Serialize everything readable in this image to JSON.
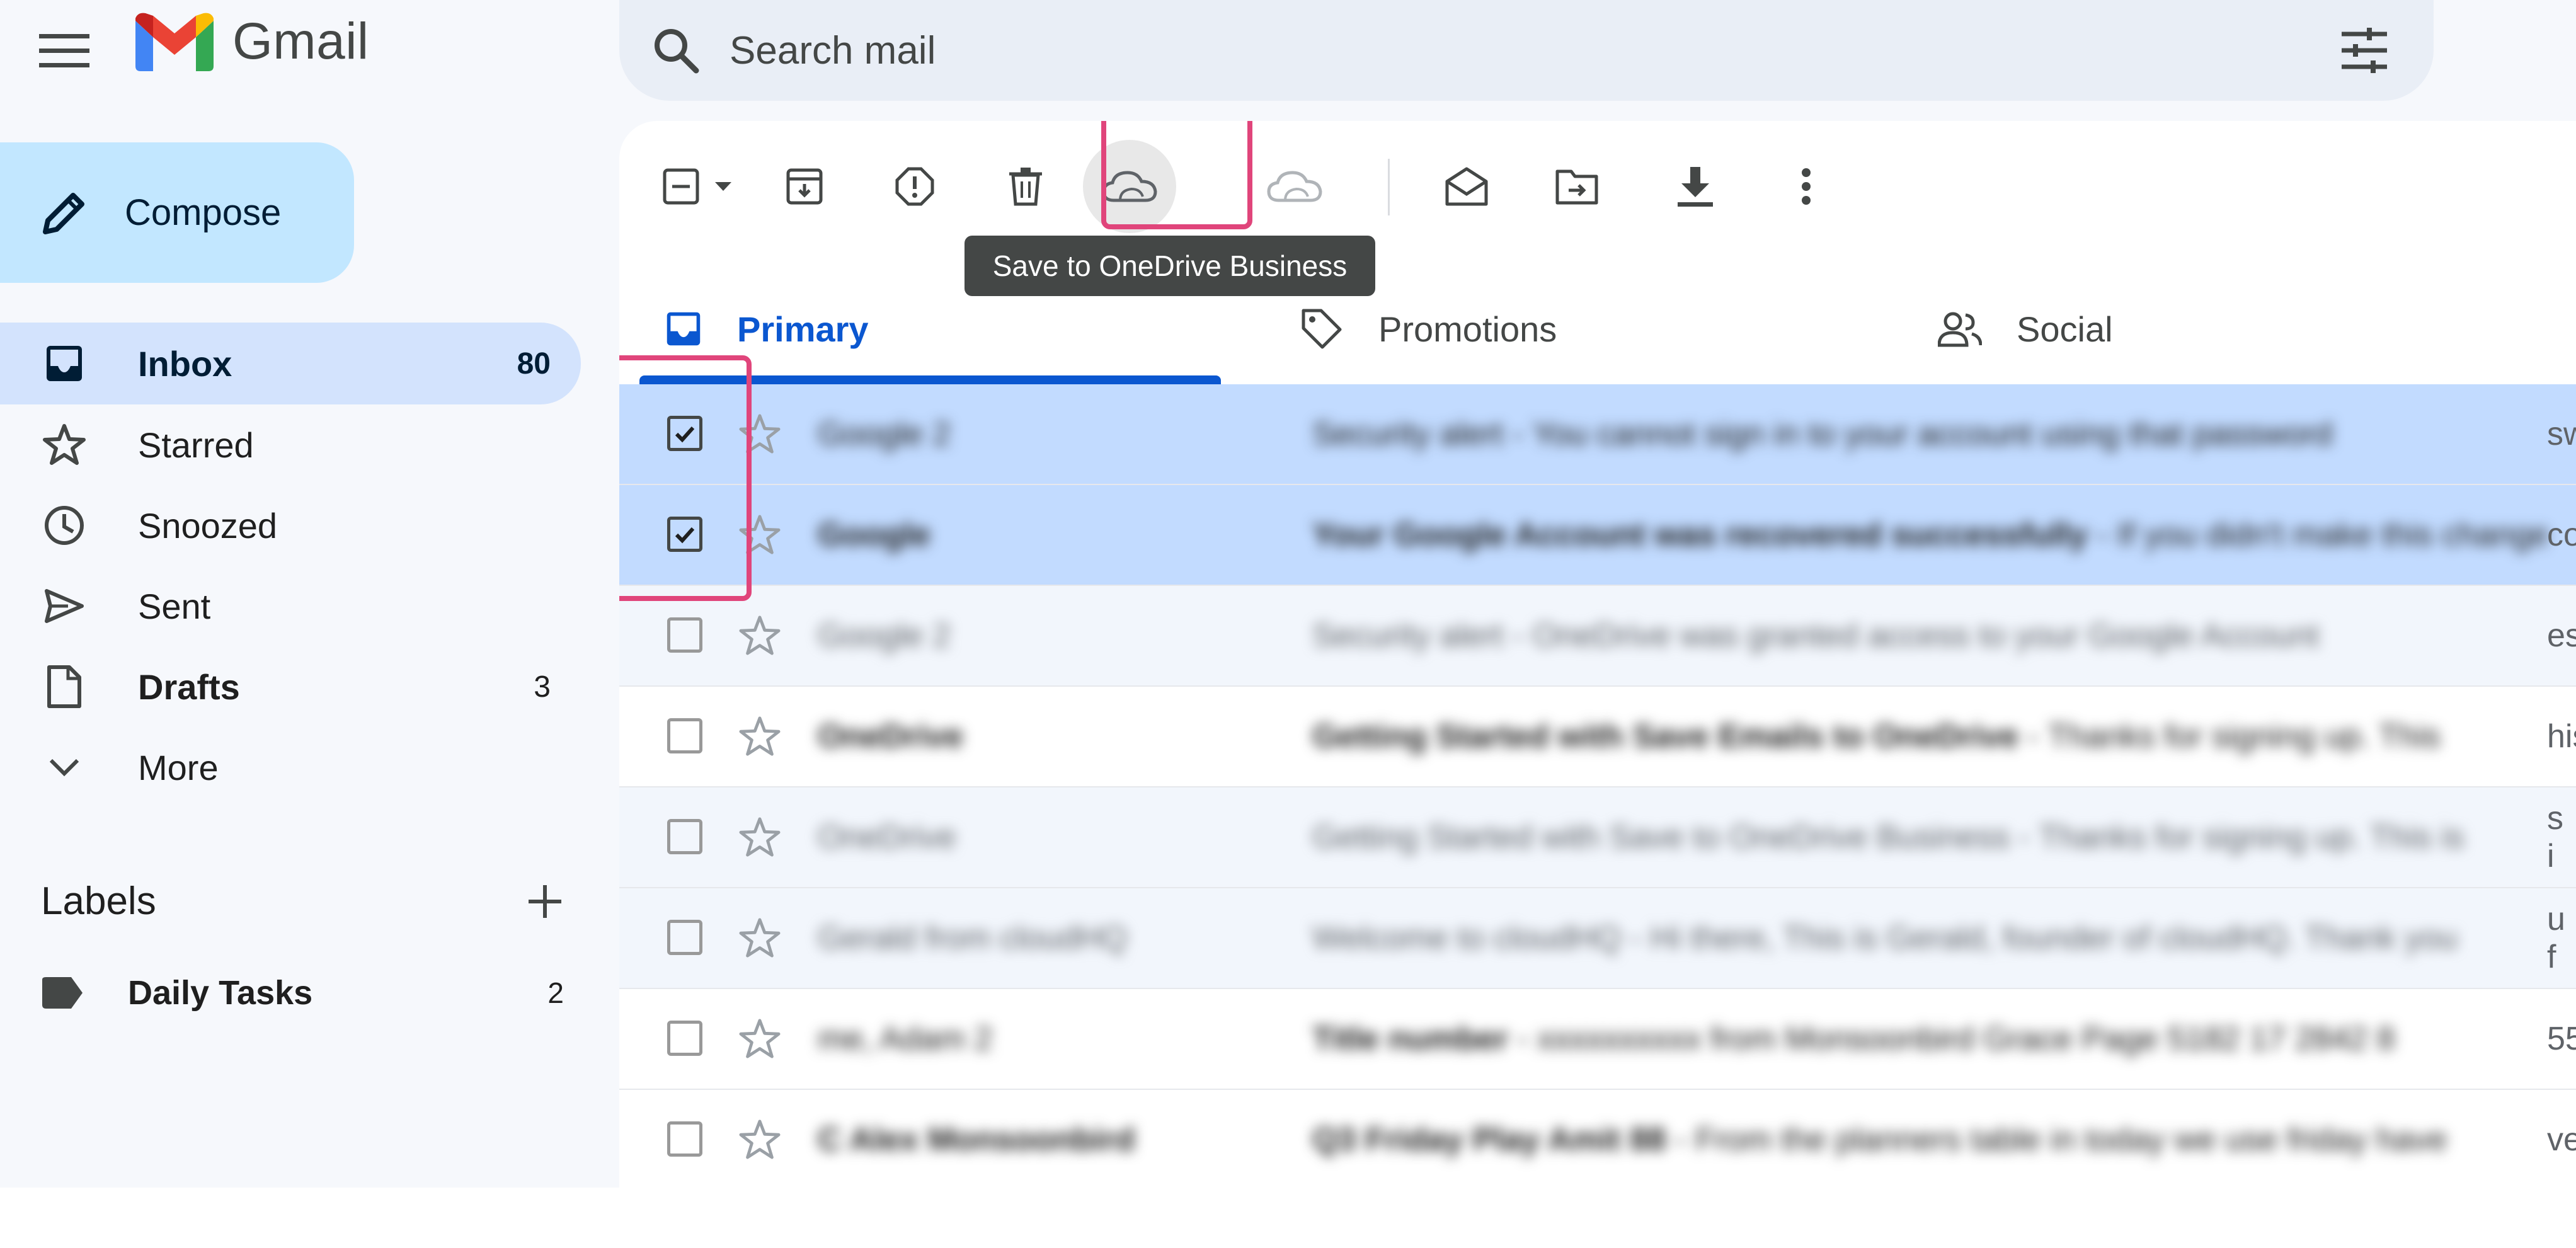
{
  "header": {
    "app_name": "Gmail",
    "search_placeholder": "Search mail"
  },
  "sidebar": {
    "compose_label": "Compose",
    "items": [
      {
        "label": "Inbox",
        "count": "80",
        "icon": "inbox-icon"
      },
      {
        "label": "Starred",
        "count": "",
        "icon": "star-icon"
      },
      {
        "label": "Snoozed",
        "count": "",
        "icon": "clock-icon"
      },
      {
        "label": "Sent",
        "count": "",
        "icon": "send-icon"
      },
      {
        "label": "Drafts",
        "count": "3",
        "icon": "draft-icon"
      },
      {
        "label": "More",
        "count": "",
        "icon": "chevron-down-icon"
      }
    ],
    "labels_title": "Labels",
    "labels": [
      {
        "label": "Daily Tasks",
        "count": "2"
      }
    ]
  },
  "toolbar": {
    "tooltip": "Save to OneDrive Business",
    "buttons": [
      "select-all",
      "archive",
      "report-spam",
      "delete",
      "save-to-onedrive-business",
      "save-to-onedrive",
      "mark-as-read",
      "move-to",
      "download",
      "more"
    ]
  },
  "tabs": [
    {
      "label": "Primary",
      "active": true
    },
    {
      "label": "Promotions",
      "active": false
    },
    {
      "label": "Social",
      "active": false
    }
  ],
  "emails": [
    {
      "sender": "Google 2",
      "subject": "Security alert",
      "snippet": "You cannot sign in to your account using that password",
      "selected": true,
      "unread": false,
      "edge": "sw"
    },
    {
      "sender": "Google",
      "subject": "Your Google Account was recovered successfully",
      "snippet": "If you didn't make this change please secure your account",
      "selected": true,
      "unread": true,
      "edge": "co"
    },
    {
      "sender": "Google 2",
      "subject": "Security alert",
      "snippet": "OneDrive was granted access to your Google Account",
      "selected": false,
      "unread": false,
      "edge": "es"
    },
    {
      "sender": "OneDrive",
      "subject": "Getting Started with Save Emails to OneDrive",
      "snippet": "Thanks for signing up. This",
      "selected": false,
      "unread": true,
      "edge": "his"
    },
    {
      "sender": "OneDrive",
      "subject": "Getting Started with Save to OneDrive Business",
      "snippet": "Thanks for signing up. This is",
      "selected": false,
      "unread": false,
      "edge": "s i"
    },
    {
      "sender": "Gerald from cloudHQ",
      "subject": "Welcome to cloudHQ",
      "snippet": "Hi there, This is Gerald, founder of cloudHQ. Thank you",
      "selected": false,
      "unread": false,
      "edge": "u f"
    },
    {
      "sender": "me, Adam 2",
      "subject": "Title number",
      "snippet": "xxxxxxxxxx from Monsoonbird Grace Page 5182 17 2842 8",
      "selected": false,
      "unread": true,
      "edge": "55"
    },
    {
      "sender": "C Alex Monsoonbird",
      "subject": "Q3 Friday Play Amit 88",
      "snippet": "From the planners table in today we use friday have",
      "selected": false,
      "unread": true,
      "edge": "ve"
    }
  ],
  "colors": {
    "accent": "#0b57d0",
    "selected_row": "#c2dbff",
    "highlight": "#e0457b",
    "compose_bg": "#c2e7ff",
    "gmail_red": "#ea4335",
    "gmail_blue": "#4285f4",
    "gmail_green": "#34a853",
    "gmail_yellow": "#fbbc04"
  }
}
